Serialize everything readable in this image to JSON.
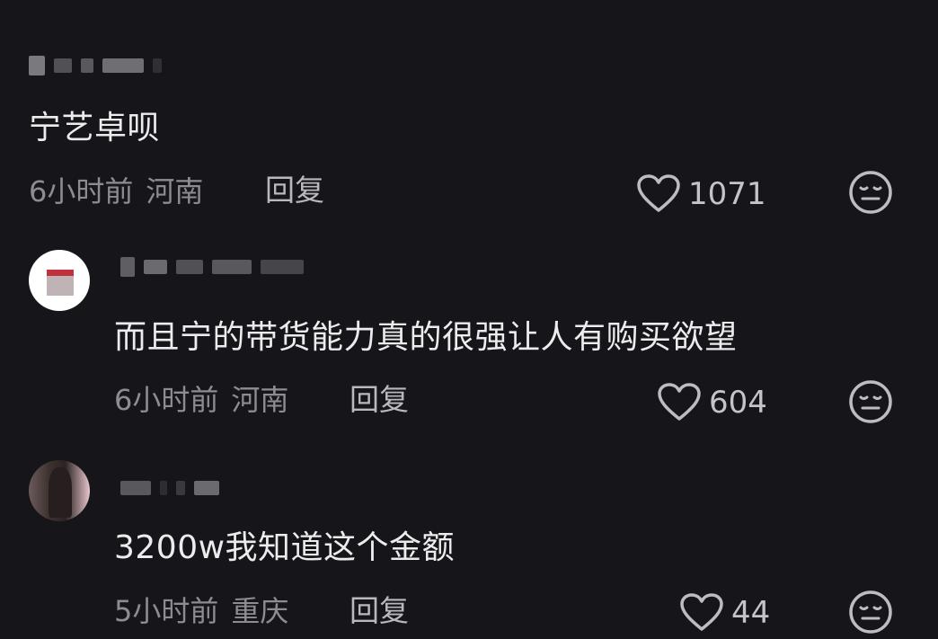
{
  "comments": [
    {
      "text": "宁艺卓呗",
      "time": "6小时前",
      "location": "河南",
      "reply_label": "回复",
      "likes": "1071",
      "like_icon": "heart-outline-icon",
      "reaction_icon": "expressionless-face-icon"
    },
    {
      "text": "而且宁的带货能力真的很强让人有购买欲望",
      "time": "6小时前",
      "location": "河南",
      "reply_label": "回复",
      "likes": "604",
      "like_icon": "heart-outline-icon",
      "reaction_icon": "expressionless-face-icon"
    },
    {
      "text": "3200w我知道这个金额",
      "time": "5小时前",
      "location": "重庆",
      "reply_label": "回复",
      "likes": "44",
      "like_icon": "heart-outline-icon",
      "reaction_icon": "expressionless-face-icon"
    }
  ],
  "colors": {
    "background": "#161519",
    "text": "#ececee",
    "meta": "#8d8d91",
    "icon": "#bdbdc1"
  }
}
